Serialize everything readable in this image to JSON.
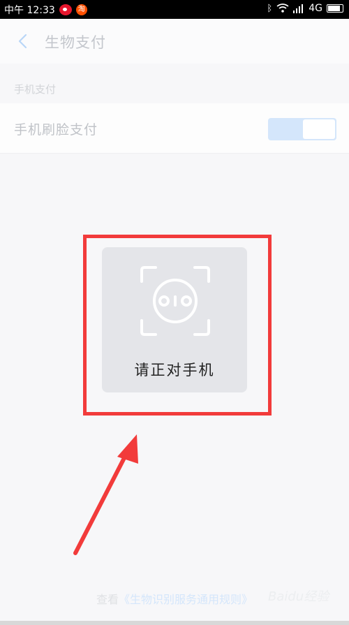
{
  "status_bar": {
    "carrier_time": "中午 12:33",
    "taobao_glyph": "淘",
    "network": "4G",
    "icons": [
      "weibo-icon",
      "taobao-icon",
      "bluetooth-icon",
      "wifi-icon",
      "signal-icon",
      "battery-icon"
    ]
  },
  "nav": {
    "back_icon": "chevron-left-icon",
    "title": "生物支付"
  },
  "section": {
    "label": "手机支付"
  },
  "setting": {
    "label": "手机刷脸支付",
    "toggle_on": true
  },
  "face_dialog": {
    "icon": "face-scan-icon",
    "prompt": "请正对手机"
  },
  "footer": {
    "prefix": "查看",
    "link": "《生物识别服务通用规则》"
  },
  "watermark": "Baidu经验",
  "colors": {
    "highlight": "#f23b3b",
    "toggle_bg": "#d4e6fb",
    "accent": "#4a90e2"
  }
}
